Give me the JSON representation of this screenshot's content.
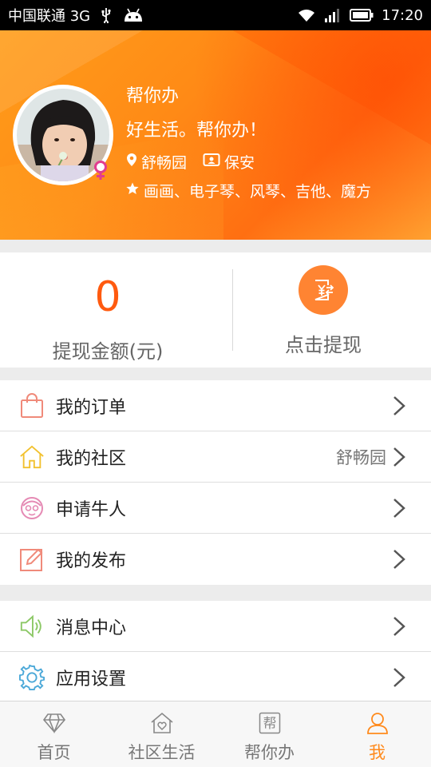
{
  "status_bar": {
    "carrier": "中国联通 3G",
    "time": "17:20"
  },
  "profile": {
    "name": "帮你办",
    "slogan": "好生活。帮你办！",
    "community": "舒畅园",
    "job": "保安",
    "hobbies": "画画、电子琴、风琴、吉他、魔方",
    "gender": "female"
  },
  "balance": {
    "amount": "0",
    "amount_label": "提现金额(元)",
    "withdraw_label": "点击提现"
  },
  "menu_group_1": [
    {
      "label": "我的订单",
      "icon": "shopping-bag-icon"
    },
    {
      "label": "我的社区",
      "icon": "house-icon",
      "value": "舒畅园"
    },
    {
      "label": "申请牛人",
      "icon": "person-face-icon"
    },
    {
      "label": "我的发布",
      "icon": "edit-icon"
    }
  ],
  "menu_group_2": [
    {
      "label": "消息中心",
      "icon": "speaker-icon"
    },
    {
      "label": "应用设置",
      "icon": "gear-icon"
    }
  ],
  "tabs": [
    {
      "label": "首页",
      "icon": "diamond-icon"
    },
    {
      "label": "社区生活",
      "icon": "home-heart-icon"
    },
    {
      "label": "帮你办",
      "icon": "bang-icon",
      "icon_text": "帮"
    },
    {
      "label": "我",
      "icon": "user-icon",
      "active": true
    }
  ],
  "colors": {
    "accent": "#ff8a1c",
    "amount": "#ff5a0f",
    "header": "#ff8c17"
  }
}
